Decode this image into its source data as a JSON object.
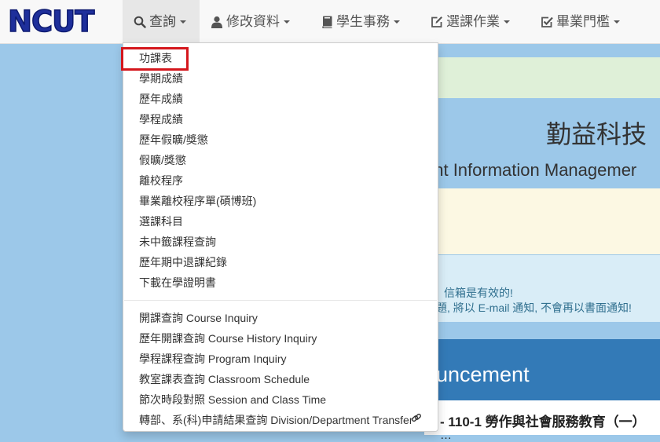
{
  "brand": {
    "logo_text": "NCUT"
  },
  "nav": {
    "query": "查詢",
    "modify_data": "修改資料",
    "student_affairs": "學生事務",
    "course_selection": "選課作業",
    "graduation": "畢業門檻"
  },
  "dropdown": {
    "items": [
      "功課表",
      "學期成績",
      "歷年成績",
      "學程成績",
      "歷年假曠/獎懲",
      "假曠/獎懲",
      "離校程序",
      "畢業離校程序單(碩博班)",
      "選課科目",
      "未中籤課程查詢",
      "歷年期中退課紀錄",
      "下載在學證明書"
    ],
    "bilingual_items": [
      "開課查詢 Course Inquiry",
      "歷年開課查詢 Course History Inquiry",
      "學程課程查詢 Program Inquiry",
      "教室課表查詢 Classroom Schedule",
      "節次時段對照 Session and Class Time",
      "轉部、系(科)申請結果查詢 Division/Department Transfer"
    ],
    "highlighted_index": 0
  },
  "page": {
    "school_name": "勤益科技",
    "subtitle": "ent Information Managemer",
    "notice_line1": "信箱是有效的!",
    "notice_line2": "題, 將以 E-mail 通知, 不會再以書面通知!",
    "announcement_heading": "uncement",
    "news_line1": "- 110-1 勞作與社會服務教育（一）",
    "news_line2": "…"
  },
  "colors": {
    "brand": "#1e2f9b",
    "background": "#9cc8e9",
    "highlight_box": "#d4161c",
    "announcement_bar": "#337ab7",
    "info_text": "#31708f"
  }
}
